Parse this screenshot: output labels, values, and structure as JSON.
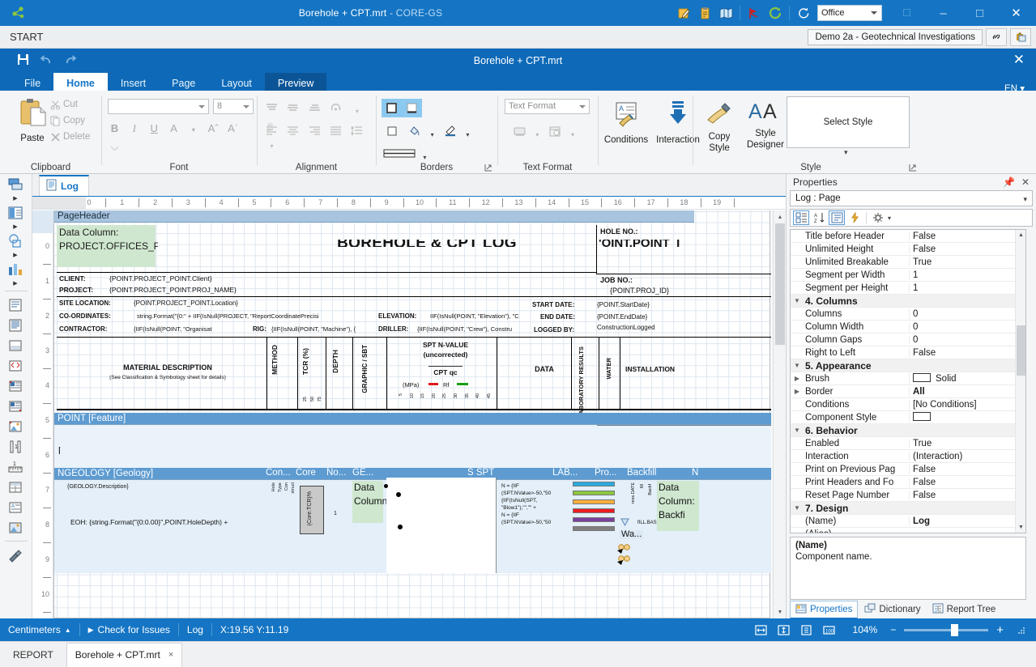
{
  "titlebar": {
    "title": "Borehole + CPT.mrt",
    "app_suffix": " - CORE-GS",
    "theme_value": "Office",
    "icons": [
      "edit-report-icon",
      "clipboard-icon",
      "map-icon",
      "run-icon",
      "refresh-icon",
      "reload-icon"
    ],
    "window_buttons": [
      "restore-down-icon",
      "minimize-icon",
      "maximize-icon",
      "close-icon"
    ]
  },
  "startbar": {
    "label": "START",
    "project": "Demo 2a - Geotechnical Investigations",
    "buttons": [
      "link-icon",
      "briefcase-icon"
    ]
  },
  "ribbon_window": {
    "title": "Borehole + CPT.mrt",
    "quick_access": [
      "save-icon",
      "undo-icon",
      "redo-icon"
    ],
    "language": "EN",
    "close_label": "✕",
    "tabs": [
      {
        "label": "File",
        "state": "normal"
      },
      {
        "label": "Home",
        "state": "active"
      },
      {
        "label": "Insert",
        "state": "normal"
      },
      {
        "label": "Page",
        "state": "normal"
      },
      {
        "label": "Layout",
        "state": "normal"
      },
      {
        "label": "Preview",
        "state": "preview"
      }
    ]
  },
  "ribbon": {
    "clipboard": {
      "title": "Clipboard",
      "paste": "Paste",
      "items": [
        {
          "label": "Cut",
          "icon": "scissors-icon"
        },
        {
          "label": "Copy",
          "icon": "copy-icon"
        },
        {
          "label": "Delete",
          "icon": "delete-x-icon"
        }
      ]
    },
    "font": {
      "title": "Font",
      "family_value": "",
      "family_placeholder": "",
      "size_value": "8",
      "buttons": [
        "B",
        "I",
        "U",
        "A",
        "A",
        "A"
      ]
    },
    "alignment": {
      "title": "Alignment"
    },
    "borders": {
      "title": "Borders"
    },
    "text_format": {
      "title": "Text Format",
      "combo_value": "Text Format"
    },
    "conditions": {
      "label": "Conditions"
    },
    "interaction": {
      "label": "Interaction"
    },
    "copy_style": {
      "label_line1": "Copy",
      "label_line2": "Style"
    },
    "style_designer": {
      "label_line1": "Style",
      "label_line2": "Designer"
    },
    "style": {
      "title": "Style",
      "select_style": "Select Style"
    }
  },
  "designer": {
    "tab": {
      "label": "Log",
      "icon": "page-icon"
    },
    "h_ruler": [
      "0",
      "1",
      "2",
      "3",
      "4",
      "5",
      "6",
      "7",
      "8",
      "9",
      "10",
      "11",
      "12",
      "13",
      "14",
      "15",
      "16",
      "17",
      "18",
      "19"
    ],
    "v_ruler": [
      "0",
      "1",
      "2",
      "3",
      "4",
      "5",
      "6",
      "7",
      "8",
      "9",
      "10"
    ]
  },
  "report": {
    "bands": [
      {
        "name": "PageHeader"
      },
      {
        "name": "POINT [Feature]"
      },
      {
        "name": "NGEOLOGY [Geology]"
      }
    ],
    "page_header": {
      "data_column_selected": "Data Column: PROJECT.OFFICES_PROJECT.Lo",
      "main_title": "BOREHOLE & CPT LOG",
      "hole_no_label": "HOLE NO.:",
      "hole_no_value": "'OINT.POINT_I",
      "job_no_label": "JOB NO.:",
      "job_no_value": "{POINT.PROJ_ID}",
      "rows": [
        {
          "label": "CLIENT:",
          "value": "{POINT.PROJECT_POINT.Client}"
        },
        {
          "label": "PROJECT:",
          "value": "{POINT.PROJECT_POINT.PROJ_NAME}"
        },
        {
          "label": "SITE LOCATION:",
          "value": "{POINT.PROJECT_POINT.Location}"
        },
        {
          "label": "CO-ORDINATES:",
          "value": "string.Format(\"{0:\" + IIF(IsNull(PROJECT, \"ReportCoordinatePrecisi"
        },
        {
          "label": "CONTRACTOR:",
          "value": "{IIF(IsNull(POINT, \"Organisat"
        }
      ],
      "right_rows": [
        {
          "label": "ELEVATION:",
          "value": "IIF(IsNull(POINT, \"Elevation\"), \"C"
        },
        {
          "label": "RIG:",
          "value": "{IIF(IsNull(POINT, \"Machine\"), {"
        },
        {
          "label": "DRILLER:",
          "value": "{IIF(IsNull(POINT, \"Crew\"), Constru"
        },
        {
          "label": "START DATE:",
          "value": "{POINT.StartDate}"
        },
        {
          "label": "END DATE:",
          "value": "{POINT.EndDate}"
        },
        {
          "label": "LOGGED BY:",
          "value": "ConstructionLogged"
        }
      ],
      "columns": [
        {
          "title": "MATERIAL DESCRIPTION",
          "subtitle": "(See Classification & Symbology sheet for details)"
        },
        {
          "title": "METHOD"
        },
        {
          "title": "TCR (%)",
          "ticks": [
            "25",
            "50",
            "75"
          ]
        },
        {
          "title": "DEPTH"
        },
        {
          "title": "GRAPHIC / SBT"
        },
        {
          "title": "SPT N-VALUE",
          "line2": "(uncorrected)",
          "line3": "CPT qc",
          "line4": "(MPa)",
          "legend1": "Rf",
          "ticks": [
            "5",
            "10",
            "15",
            "20",
            "25",
            "30",
            "35",
            "40",
            "45"
          ]
        },
        {
          "title": "DATA"
        },
        {
          "title": "LABORATORY RESULTS"
        },
        {
          "title": "WATER"
        },
        {
          "title": "INSTALLATION"
        }
      ]
    },
    "geology_band": {
      "description_expr": "{GEOLOGY.Description}",
      "eoh_expr": "EOH: {string.Format(\"{0:0.00}\",POINT.HoleDepth) + ",
      "mini_headers": [
        "Con...",
        "Core",
        "No...",
        "GE...",
        "S SPT",
        "LAB...",
        "Pro...",
        "Backfill",
        "N"
      ],
      "construction_labels": [
        "Hole",
        "Type",
        "Con",
        "struct"
      ],
      "core_tcr_expr": "{Core.TCR}%",
      "graphic_data_column": "Data Column:",
      "spt_exprs": [
        "N = {IIF",
        "(SPT.NValue>-50,\"50",
        "{IIF(IsNull(SPT,",
        "\"Blow1\"),\"\",\"\" +",
        "N = {IIF",
        "(SPT.NValue>-50,\"50"
      ],
      "backfill_data_column": "Data Column: Backfi",
      "water_label": "Wa...",
      "lab_colors": [
        "#29abe2",
        "#8cc63f",
        "#fbb03b",
        "#ed1c24",
        "#7b3f9e",
        "#808080"
      ],
      "prog_label": "ress.DATE",
      "fill_labels": [
        "fill",
        "Backf",
        "fILL.BAS"
      ]
    }
  },
  "properties": {
    "header": "Properties",
    "pin_icon": "pin-icon",
    "close_icon": "close-icon",
    "selector": "Log : Page",
    "toolbar_icons": [
      "categorized-icon",
      "alphabetical-icon",
      "properties-icon",
      "events-icon",
      "settings-icon"
    ],
    "rows": [
      {
        "type": "prop",
        "key": "Title before Header",
        "value": "False"
      },
      {
        "type": "prop",
        "key": "Unlimited Height",
        "value": "False"
      },
      {
        "type": "prop",
        "key": "Unlimited Breakable",
        "value": "True"
      },
      {
        "type": "prop",
        "key": "Segment per Width",
        "value": "1"
      },
      {
        "type": "prop",
        "key": "Segment per Height",
        "value": "1"
      },
      {
        "type": "cat",
        "key": "4. Columns",
        "value": ""
      },
      {
        "type": "prop",
        "key": "Columns",
        "value": "0"
      },
      {
        "type": "prop",
        "key": "Column Width",
        "value": "0"
      },
      {
        "type": "prop",
        "key": "Column Gaps",
        "value": "0"
      },
      {
        "type": "prop",
        "key": "Right to Left",
        "value": "False"
      },
      {
        "type": "cat",
        "key": "5. Appearance",
        "value": ""
      },
      {
        "type": "swatch",
        "key": "Brush",
        "value": "Solid",
        "expand": true
      },
      {
        "type": "bold",
        "key": "Border",
        "value": "All",
        "expand": true
      },
      {
        "type": "prop",
        "key": "Conditions",
        "value": "[No Conditions]"
      },
      {
        "type": "swatch",
        "key": "Component Style",
        "value": ""
      },
      {
        "type": "cat",
        "key": "6. Behavior",
        "value": ""
      },
      {
        "type": "prop",
        "key": "Enabled",
        "value": "True"
      },
      {
        "type": "prop",
        "key": "Interaction",
        "value": "(Interaction)"
      },
      {
        "type": "prop",
        "key": "Print on Previous Pag",
        "value": "False"
      },
      {
        "type": "prop",
        "key": "Print Headers and Fo",
        "value": "False"
      },
      {
        "type": "prop",
        "key": "Reset Page Number",
        "value": "False"
      },
      {
        "type": "cat",
        "key": "7. Design",
        "value": ""
      },
      {
        "type": "bold",
        "key": "(Name)",
        "value": "Log"
      },
      {
        "type": "prop",
        "key": "(Alias)",
        "value": ""
      }
    ],
    "description": {
      "title": "(Name)",
      "text": "Component name."
    },
    "tabs": [
      {
        "label": "Properties",
        "icon": "properties-icon",
        "active": true
      },
      {
        "label": "Dictionary",
        "icon": "dictionary-icon",
        "active": false
      },
      {
        "label": "Report Tree",
        "icon": "tree-icon",
        "active": false
      }
    ]
  },
  "status": {
    "units": "Centimeters",
    "check_for_issues": "Check for Issues",
    "page": "Log",
    "coords": "X:19.56 Y:11.19",
    "zoom": "104%",
    "zoom_minus": "−",
    "zoom_plus": "+",
    "view_icons": [
      "fit-width-icon",
      "fit-height-icon",
      "one-page-icon",
      "actual-size-icon"
    ]
  },
  "bottom": {
    "label": "REPORT",
    "tab": "Borehole + CPT.mrt",
    "close": "×"
  }
}
